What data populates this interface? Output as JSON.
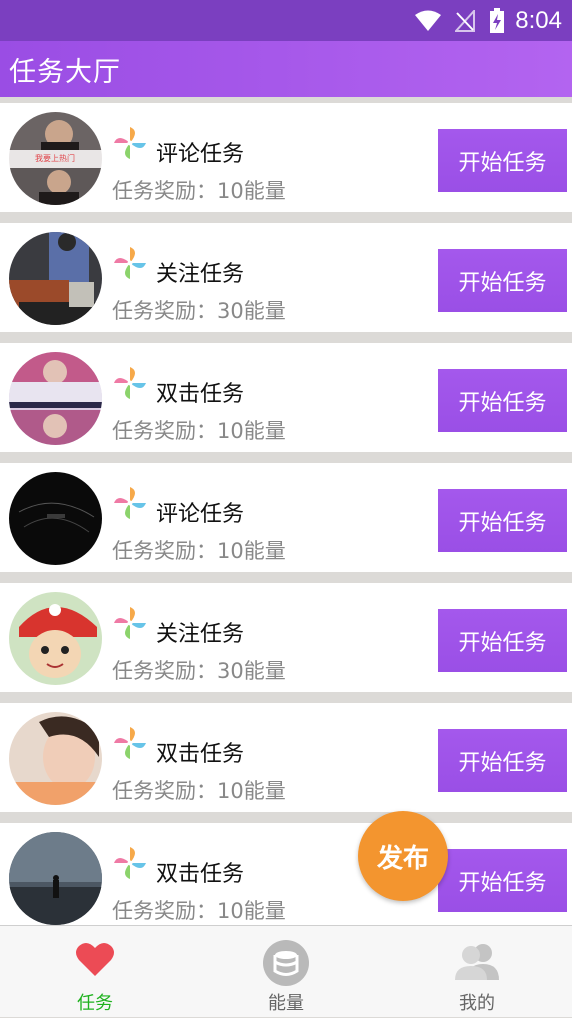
{
  "status_bar": {
    "time": "8:04"
  },
  "app_bar": {
    "title": "任务大厅"
  },
  "tasks": [
    {
      "name": "评论任务",
      "reward": "任务奖励：10能量",
      "button": "开始任务",
      "avatar_caption": "我要上热门"
    },
    {
      "name": "关注任务",
      "reward": "任务奖励：30能量",
      "button": "开始任务"
    },
    {
      "name": "双击任务",
      "reward": "任务奖励：10能量",
      "button": "开始任务"
    },
    {
      "name": "评论任务",
      "reward": "任务奖励：10能量",
      "button": "开始任务"
    },
    {
      "name": "关注任务",
      "reward": "任务奖励：30能量",
      "button": "开始任务"
    },
    {
      "name": "双击任务",
      "reward": "任务奖励：10能量",
      "button": "开始任务"
    },
    {
      "name": "双击任务",
      "reward": "任务奖励：10能量",
      "button": "开始任务"
    }
  ],
  "fab": {
    "label": "发布"
  },
  "bottom_nav": {
    "items": [
      {
        "label": "任务",
        "icon": "heart-icon",
        "active": true
      },
      {
        "label": "能量",
        "icon": "database-icon",
        "active": false
      },
      {
        "label": "我的",
        "icon": "user-icon",
        "active": false
      }
    ]
  },
  "colors": {
    "status_bar": "#7b3fc0",
    "app_bar": "#a158ea",
    "button": "#9f55ea",
    "fab": "#f3952f",
    "active_nav": "#1fb21f",
    "reward_text": "#888888"
  }
}
